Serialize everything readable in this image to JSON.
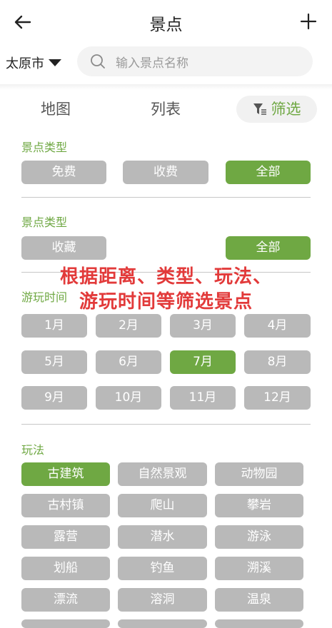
{
  "header": {
    "title": "景点"
  },
  "location": {
    "city": "太原市"
  },
  "search": {
    "placeholder": "输入景点名称"
  },
  "tabs": {
    "map": "地图",
    "list": "列表",
    "filter": "筛选"
  },
  "sections": {
    "type": {
      "title": "景点类型",
      "chips": [
        "免费",
        "收费",
        "全部"
      ],
      "selected": "全部"
    },
    "collect": {
      "title": "景点类型",
      "chips": [
        "收藏",
        "全部"
      ],
      "selected": "全部"
    },
    "time": {
      "title": "游玩时间",
      "chips": [
        "1月",
        "2月",
        "3月",
        "4月",
        "5月",
        "6月",
        "7月",
        "8月",
        "9月",
        "10月",
        "11月",
        "12月"
      ],
      "selected": "7月"
    },
    "play": {
      "title": "玩法",
      "chips": [
        "古建筑",
        "自然景观",
        "动物园",
        "古村镇",
        "爬山",
        "攀岩",
        "露营",
        "潜水",
        "游泳",
        "划船",
        "钓鱼",
        "溯溪",
        "漂流",
        "溶洞",
        "温泉"
      ],
      "selected": "古建筑"
    }
  },
  "overlay": {
    "line1": "根据距离、类型、玩法、",
    "line2": "游玩时间等筛选景点"
  },
  "colors": {
    "accent": "#6fa843",
    "chip": "#b9b9b9",
    "overlay": "#e23a3a"
  }
}
